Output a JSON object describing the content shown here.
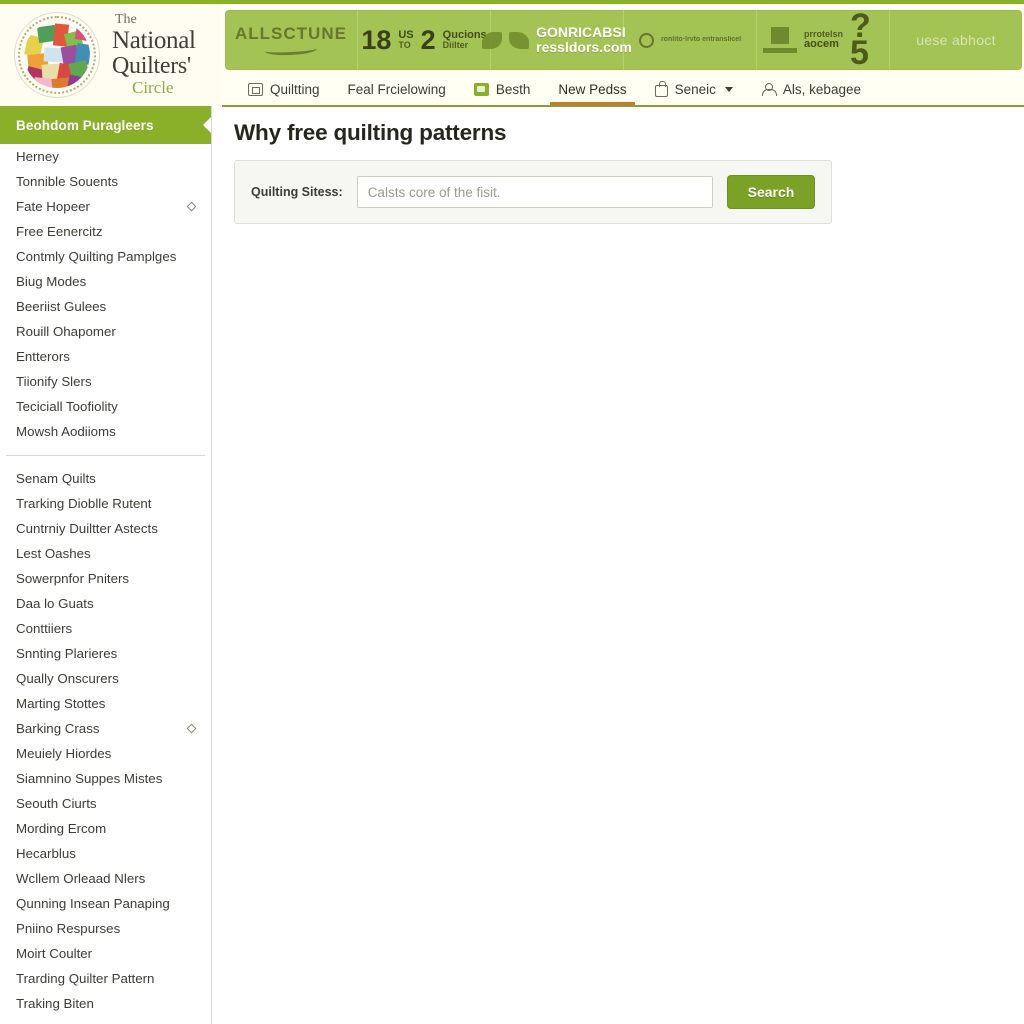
{
  "brand": {
    "the": "The",
    "name_line1": "National",
    "name_line2": "Quilters'",
    "name_line3": "Circle"
  },
  "banner": {
    "cells": [
      {
        "id": "amazon",
        "text": "ALLSCTUNE"
      },
      {
        "id": "stats",
        "num1": "18",
        "stack1_top": "US",
        "stack1_bot": "TO",
        "num2": "2",
        "stack2_top": "Qucions",
        "stack2_bot": "Diilter"
      },
      {
        "id": "leaf-brand",
        "title": "GONRICABSI",
        "subtitle": "ressldors.com"
      },
      {
        "id": "partner",
        "text": "ronlito·lrvto entranslicel"
      },
      {
        "id": "podium",
        "text_small": "prrotelsn",
        "text": "aocem",
        "mark": "?5"
      },
      {
        "id": "last",
        "text": "uese abhoct"
      }
    ]
  },
  "nav": {
    "items": [
      {
        "label": "Quiltting",
        "icon": "camera-icon",
        "active": false,
        "caret": false
      },
      {
        "label": "Feal Frcielowing",
        "icon": "none",
        "active": false,
        "caret": false
      },
      {
        "label": "Besth",
        "icon": "green-square-icon",
        "active": false,
        "caret": false
      },
      {
        "label": "New Pedss",
        "icon": "none",
        "active": true,
        "caret": false
      },
      {
        "label": "Seneic",
        "icon": "lock-icon",
        "active": false,
        "caret": true
      },
      {
        "label": "Als, kebagee",
        "icon": "person-icon",
        "active": false,
        "caret": false
      }
    ]
  },
  "sidebar": {
    "header": "Beohdom Puragleers",
    "groups": [
      {
        "items": [
          {
            "label": "Herney",
            "marker": false
          },
          {
            "label": "Tonnible Souents",
            "marker": false
          },
          {
            "label": "Fate Hopeer",
            "marker": true
          },
          {
            "label": "Free Eenercitz",
            "marker": false
          },
          {
            "label": "Contmly Quilting Pamplges",
            "marker": false
          },
          {
            "label": "Biug Modes",
            "marker": false
          },
          {
            "label": "Beeriist Gulees",
            "marker": false
          },
          {
            "label": "Rouill Ohapomer",
            "marker": false
          },
          {
            "label": "Entterors",
            "marker": false
          },
          {
            "label": "Tiionify Slers",
            "marker": false
          },
          {
            "label": "Teciciall Toofiolity",
            "marker": false
          },
          {
            "label": "Mowsh Aodiioms",
            "marker": false
          }
        ]
      },
      {
        "items": [
          {
            "label": "Senam Quilts",
            "marker": false
          },
          {
            "label": "Trarking Dioblle Rutent",
            "marker": false
          },
          {
            "label": "Cuntrniy Duiltter Astects",
            "marker": false
          },
          {
            "label": "Lest Oashes",
            "marker": false
          },
          {
            "label": "Sowerpnfor Pniters",
            "marker": false
          },
          {
            "label": "Daa lo Guats",
            "marker": false
          },
          {
            "label": "Conttiiers",
            "marker": false
          },
          {
            "label": "Snnting Plarieres",
            "marker": false
          },
          {
            "label": "Qually Onscurers",
            "marker": false
          },
          {
            "label": "Marting Stottes",
            "marker": false
          },
          {
            "label": "Barking Crass",
            "marker": true
          },
          {
            "label": "Meuiely Hiordes",
            "marker": false
          },
          {
            "label": "Siamnino Suppes Mistes",
            "marker": false
          },
          {
            "label": "Seouth Ciurts",
            "marker": false
          },
          {
            "label": "Mording Ercom",
            "marker": false
          },
          {
            "label": "Hecarblus",
            "marker": false
          },
          {
            "label": "Wcllem Orleaad Nlers",
            "marker": false
          },
          {
            "label": "Qunning Insean Panaping",
            "marker": false
          },
          {
            "label": "Pniino Respurses",
            "marker": false
          },
          {
            "label": "Moirt Coulter",
            "marker": false
          },
          {
            "label": "Trarding Quilter Pattern",
            "marker": false
          },
          {
            "label": "Traking Biten",
            "marker": false
          }
        ]
      }
    ]
  },
  "main": {
    "title": "Why free quilting patterns",
    "search": {
      "label": "Quilting Sitess:",
      "placeholder": "Calsts core of the fisit.",
      "value": "",
      "button": "Search"
    }
  },
  "colors": {
    "brand_green": "#8ab02a",
    "banner_green": "#a3c355",
    "button_green": "#7ba227",
    "active_tab_orange": "#cc7722",
    "panel_bg": "#f6f6f2"
  }
}
